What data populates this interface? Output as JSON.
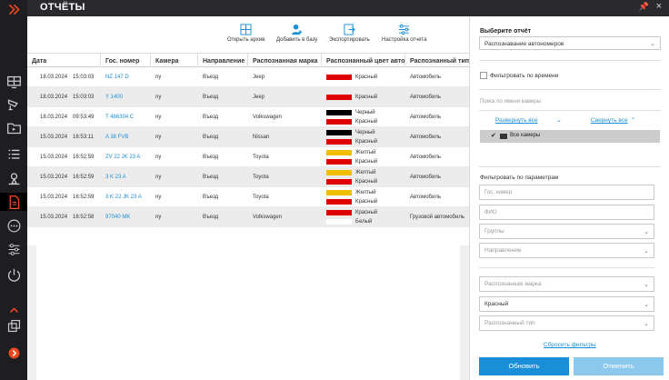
{
  "header": {
    "title": "ОТЧЁТЫ"
  },
  "toolbar": {
    "open_archive": "Открыть архив",
    "add_to_base": "Добавить в базу",
    "export": "Экспортировать",
    "report_settings": "Настройка отчета"
  },
  "table": {
    "columns": [
      "Дата",
      "Гос. номер",
      "Камера",
      "Направление",
      "Распознанная марка",
      "Распознанный цвет авто",
      "Распознанный тип"
    ],
    "rows": [
      {
        "date": "18.03.2024",
        "time": "15:03:03",
        "plate": "NZ 147 D",
        "camera": "ny",
        "direction": "Въезд",
        "brand": "Jeep",
        "colors": [
          {
            "name": "Красный",
            "hex": "#e00000"
          }
        ],
        "type": "Автомобиль"
      },
      {
        "date": "18.03.2024",
        "time": "15:03:03",
        "plate": "Y 1400",
        "camera": "ny",
        "direction": "Въезд",
        "brand": "Jeep",
        "colors": [
          {
            "name": "Красный",
            "hex": "#e00000"
          }
        ],
        "type": "Автомобиль"
      },
      {
        "date": "18.03.2024",
        "time": "09:53:49",
        "plate": "T 486304 C",
        "camera": "ny",
        "direction": "Въезд",
        "brand": "Volkswagen",
        "colors": [
          {
            "name": "Черный",
            "hex": "#000000"
          },
          {
            "name": "Красный",
            "hex": "#e00000"
          }
        ],
        "type": "Автомобиль"
      },
      {
        "date": "15.03.2024",
        "time": "16:53:11",
        "plate": "A 38 FVB",
        "camera": "ny",
        "direction": "Въезд",
        "brand": "Nissan",
        "colors": [
          {
            "name": "Черный",
            "hex": "#000000"
          },
          {
            "name": "Красный",
            "hex": "#e00000"
          }
        ],
        "type": "Автомобиль"
      },
      {
        "date": "15.03.2024",
        "time": "16:52:59",
        "plate": "ZV 22 JK 23 A",
        "camera": "ny",
        "direction": "Въезд",
        "brand": "Toyota",
        "colors": [
          {
            "name": "Желтый",
            "hex": "#f0c000"
          },
          {
            "name": "Красный",
            "hex": "#e00000"
          }
        ],
        "type": "Автомобиль"
      },
      {
        "date": "15.03.2024",
        "time": "16:52:59",
        "plate": "3 K 23 A",
        "camera": "ny",
        "direction": "Въезд",
        "brand": "Toyota",
        "colors": [
          {
            "name": "Желтый",
            "hex": "#f0c000"
          },
          {
            "name": "Красный",
            "hex": "#e00000"
          }
        ],
        "type": "Автомобиль"
      },
      {
        "date": "15.03.2024",
        "time": "16:52:59",
        "plate": "3 K 22 JK 23 A",
        "camera": "ny",
        "direction": "Въезд",
        "brand": "Toyota",
        "colors": [
          {
            "name": "Желтый",
            "hex": "#f0c000"
          },
          {
            "name": "Красный",
            "hex": "#e00000"
          }
        ],
        "type": "Автомобиль"
      },
      {
        "date": "15.03.2024",
        "time": "16:52:58",
        "plate": "97040 MK",
        "camera": "ny",
        "direction": "Въезд",
        "brand": "Volkswagen",
        "colors": [
          {
            "name": "Красный",
            "hex": "#e00000"
          },
          {
            "name": "Белый",
            "hex": "#ffffff"
          }
        ],
        "type": "Грузовой автомобиль"
      }
    ]
  },
  "right_panel": {
    "select_report_label": "Выберите отчёт",
    "report_value": "Распознавание автономеров",
    "filter_by_time": "Фильтровать по времени",
    "camera_search_placeholder": "Поиск по имени камеры",
    "expand_all": "Развернуть все",
    "collapse_all": "Свернуть все",
    "all_cameras": "Все камеры",
    "filter_by_params": "Фильтровать по параметрам",
    "plate_placeholder": "Гос. номер",
    "fio_placeholder": "ФИО",
    "groups_placeholder": "Группы",
    "direction_placeholder": "Направление",
    "brand_placeholder": "Распознанная марка",
    "color_value": "Красный",
    "type_placeholder": "Распознанный тип",
    "reset_filters": "Сбросить фильтры",
    "update_button": "Обновить",
    "cancel_button": "Отменить"
  },
  "colors": {
    "accent": "#1a8fd8",
    "sidebar": "#1e1e22",
    "active_red": "#e8471f"
  },
  "sidebar_icons": [
    "collapse-icon",
    "monitor-icon",
    "camera-icon",
    "archive-icon",
    "list-icon",
    "map-icon",
    "reports-icon",
    "more-icon",
    "settings-icon",
    "power-icon",
    "layouts-icon",
    "expand-icon"
  ]
}
